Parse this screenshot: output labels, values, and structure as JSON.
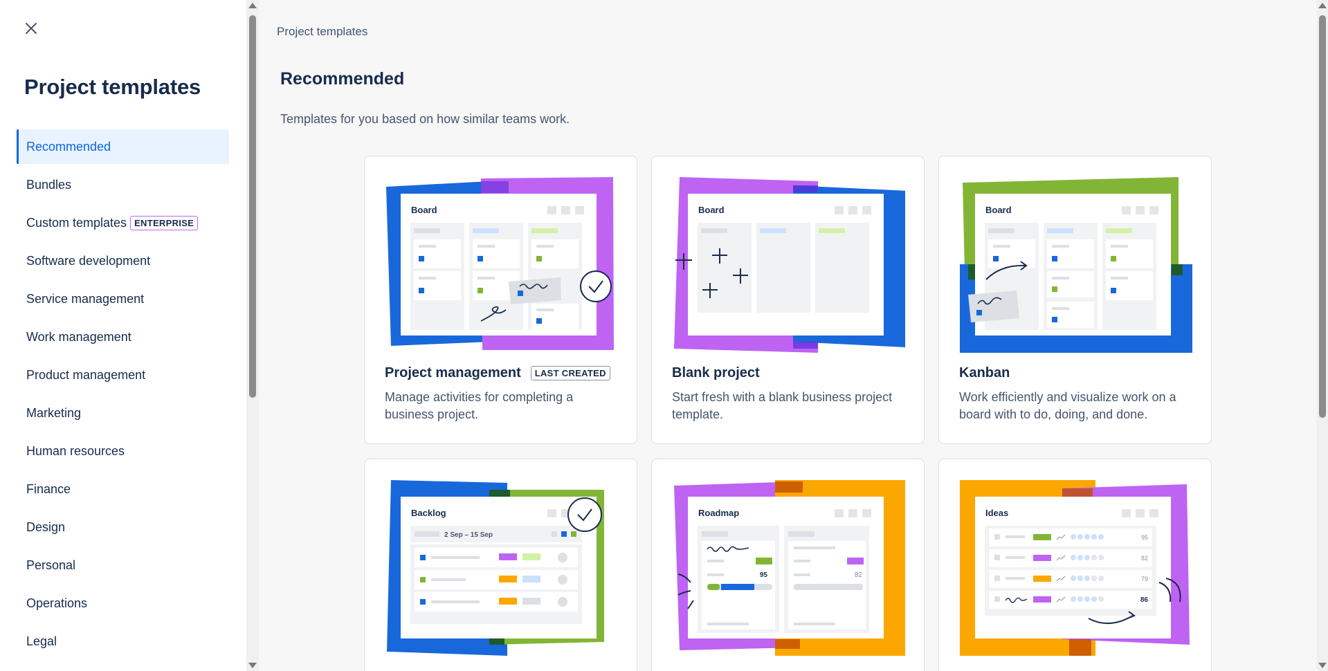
{
  "sidebar": {
    "title": "Project templates",
    "items": [
      {
        "label": "Recommended"
      },
      {
        "label": "Bundles"
      },
      {
        "label": "Custom templates",
        "badge": "ENTERPRISE"
      },
      {
        "label": "Software development"
      },
      {
        "label": "Service management"
      },
      {
        "label": "Work management"
      },
      {
        "label": "Product management"
      },
      {
        "label": "Marketing"
      },
      {
        "label": "Human resources"
      },
      {
        "label": "Finance"
      },
      {
        "label": "Design"
      },
      {
        "label": "Personal"
      },
      {
        "label": "Operations"
      },
      {
        "label": "Legal"
      }
    ]
  },
  "main": {
    "breadcrumb": "Project templates",
    "section_title": "Recommended",
    "section_desc": "Templates for you based on how similar teams work.",
    "cards": [
      {
        "title": "Project management",
        "badge": "LAST CREATED",
        "desc": "Manage activities for completing a business project.",
        "preview_label": "Board"
      },
      {
        "title": "Blank project",
        "desc": "Start fresh with a blank business project template.",
        "preview_label": "Board"
      },
      {
        "title": "Kanban",
        "desc": "Work efficiently and visualize work on a board with to do, doing, and done.",
        "preview_label": "Board"
      },
      {
        "preview_label": "Backlog",
        "preview_dates": "2 Sep – 15 Sep"
      },
      {
        "preview_label": "Roadmap",
        "preview_numbers": [
          "95",
          "82"
        ]
      },
      {
        "preview_label": "Ideas",
        "preview_scores": [
          "95",
          "82",
          "79",
          "86"
        ]
      }
    ]
  },
  "colors": {
    "accent": "#0c66e4",
    "purple": "#bf63f3",
    "blue": "#1868db",
    "green": "#82b536",
    "orange": "#fca700"
  }
}
